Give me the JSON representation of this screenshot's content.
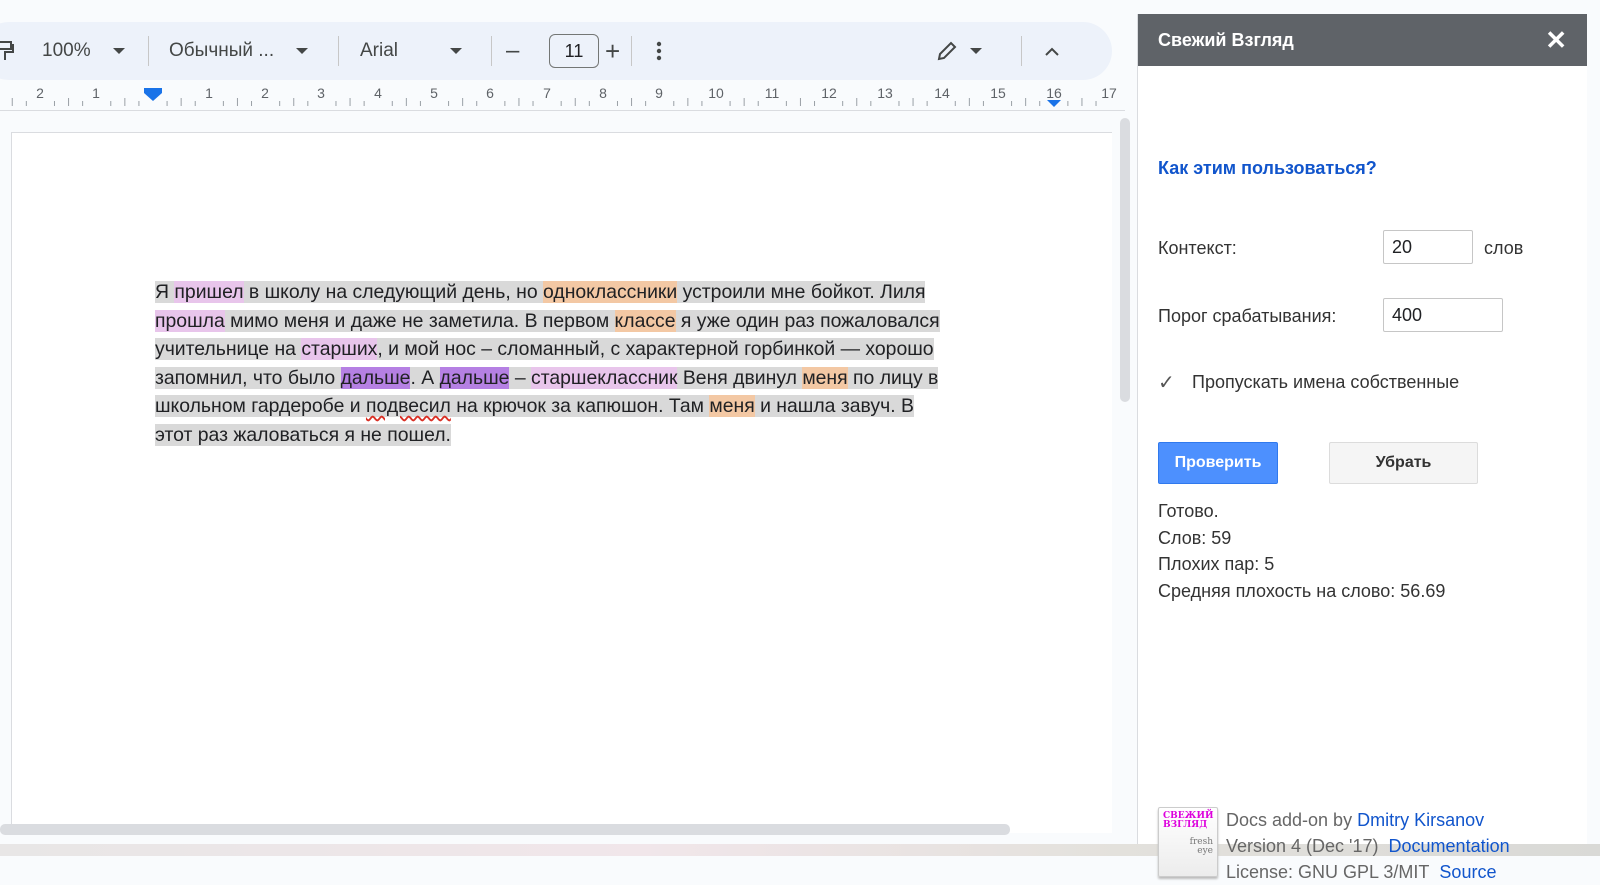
{
  "toolbar": {
    "zoom": "100%",
    "style": "Обычный ...",
    "font": "Arial",
    "font_size": "11",
    "minus": "–",
    "plus": "+"
  },
  "ruler": {
    "labels": [
      "2",
      "1",
      "1",
      "2",
      "3",
      "4",
      "5",
      "6",
      "7",
      "8",
      "9",
      "10",
      "11",
      "12",
      "13",
      "14",
      "15",
      "16",
      "17"
    ]
  },
  "document": {
    "lines": [
      [
        [
          "Я ",
          ""
        ],
        [
          "пришел",
          "hp"
        ],
        [
          " в школу на следующий день, но ",
          ""
        ],
        [
          "одноклассники",
          "ho"
        ],
        [
          " устроили мне бойкот. Лиля",
          ""
        ]
      ],
      [
        [
          "прошла",
          "hp"
        ],
        [
          " мимо меня и даже не заметила. В первом ",
          ""
        ],
        [
          "классе",
          "ho"
        ],
        [
          " я уже один раз пожаловался",
          ""
        ]
      ],
      [
        [
          "учительнице на ",
          ""
        ],
        [
          "старших",
          "hp"
        ],
        [
          ", и мой нос – сломанный, с характерной горбинкой — хорошо",
          ""
        ]
      ],
      [
        [
          "запомнил, что было ",
          ""
        ],
        [
          "дальше",
          "hpd"
        ],
        [
          ". А ",
          ""
        ],
        [
          "дальше",
          "hpd"
        ],
        [
          " – ",
          ""
        ],
        [
          "старшеклассник",
          "hp"
        ],
        [
          " Веня двинул ",
          ""
        ],
        [
          "меня",
          "ho"
        ],
        [
          " по лицу в",
          ""
        ]
      ],
      [
        [
          "школьном гардеробе и ",
          ""
        ],
        [
          "подвесил",
          "spell"
        ],
        [
          " на крючок за капюшон. Там ",
          ""
        ],
        [
          "меня",
          "ho"
        ],
        [
          " и нашла завуч. В",
          ""
        ]
      ],
      [
        [
          "этот раз жаловаться я не пошел. ",
          ""
        ]
      ]
    ]
  },
  "panel": {
    "title": "Свежий Взгляд",
    "close": "✕",
    "howto": "Как этим пользоваться?",
    "context_label": "Контекст:",
    "context_value": "20",
    "context_unit": "слов",
    "threshold_label": "Порог срабатывания:",
    "threshold_value": "400",
    "skip_names_label": "Пропускать имена собственные",
    "skip_names_checked": true,
    "check_button": "Проверить",
    "clear_button": "Убрать",
    "status": {
      "ready": "Готово.",
      "words": "Слов: 59",
      "bad_pairs": "Плохих пар: 5",
      "avg": "Средняя плохость на слово: 56.69"
    },
    "footer": {
      "line1_prefix": "Docs add-on by ",
      "author": "Dmitry Kirsanov",
      "version": "Version 4 (Dec '17)",
      "docs_link": "Documentation",
      "license": "License: GNU GPL 3/MIT",
      "source_link": "Source",
      "logo_text_top": "свежий взгляд",
      "logo_text_bottom": "fresh eye"
    }
  },
  "colors": {
    "highlight_light_purple": "#e8c5eb",
    "highlight_purple": "#b580e3",
    "highlight_orange": "#f3c8a4",
    "selection_gray": "#d9d9d9",
    "panel_header": "#5f6368",
    "primary_button": "#4d90fe",
    "link": "#1155cc"
  }
}
